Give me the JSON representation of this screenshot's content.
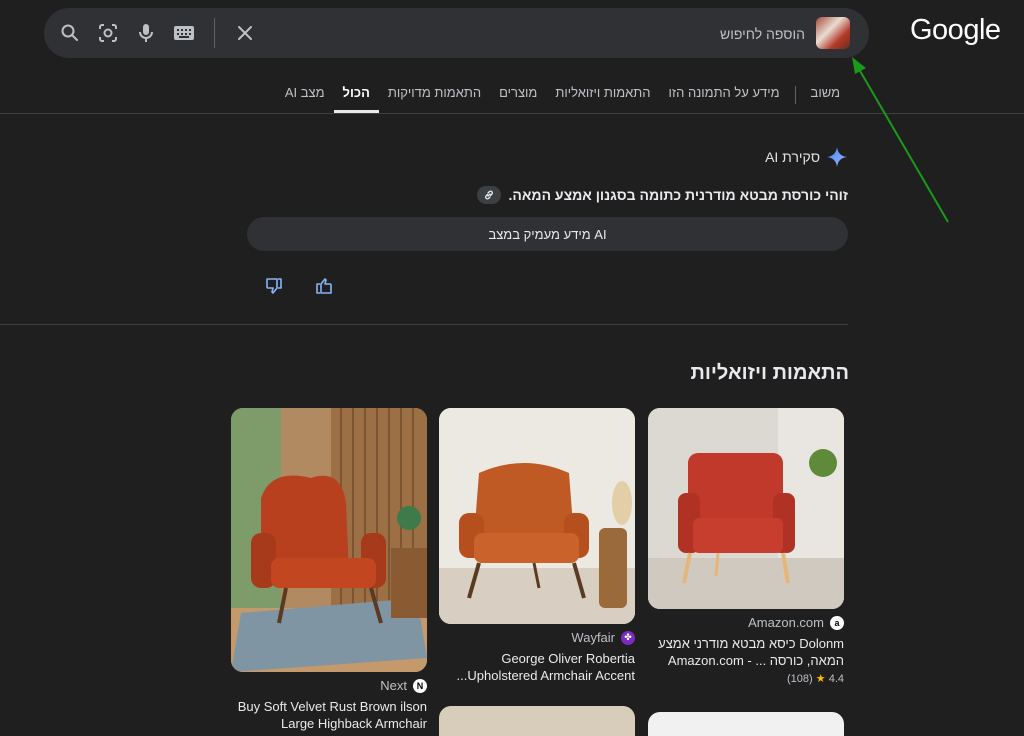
{
  "logo": "Google",
  "search": {
    "placeholder": "הוספה לחיפוש",
    "icons": [
      "search-icon",
      "lens-icon",
      "mic-icon",
      "keyboard-icon",
      "close-icon"
    ]
  },
  "tabs": [
    {
      "label": "מצב AI",
      "active": false
    },
    {
      "label": "הכול",
      "active": true
    },
    {
      "label": "התאמות מדויקות",
      "active": false
    },
    {
      "label": "מוצרים",
      "active": false
    },
    {
      "label": "התאמות ויזואליות",
      "active": false
    },
    {
      "label": "מידע על התמונה הזו",
      "active": false
    },
    {
      "label": "משוב",
      "active": false
    }
  ],
  "ai": {
    "title": "סקירת AI",
    "summary": "זוהי כורסת מבטא מודרנית כתומה בסגנון אמצע המאה.",
    "more_button": "מידע מעמיק במצב AI"
  },
  "visual_matches": {
    "title": "התאמות ויזואליות",
    "cards": [
      {
        "source": "Amazon.com",
        "title": "Dolonm כיסא מבטא מודרני אמצע המאה, כורסה ... - Amazon.com",
        "rating": "4.4",
        "reviews": "(108)"
      },
      {
        "source": "Wayfair",
        "title": "George Oliver Robertia Upholstered Armchair Accent..."
      },
      {
        "source": "Next",
        "title": "Buy Soft Velvet Rust Brown ilson Large Highback Armchair"
      }
    ]
  },
  "colors": {
    "background": "#1f1f1f",
    "searchbar": "#303134",
    "accent": "#8ab4f8",
    "chair": "#c0392b"
  }
}
